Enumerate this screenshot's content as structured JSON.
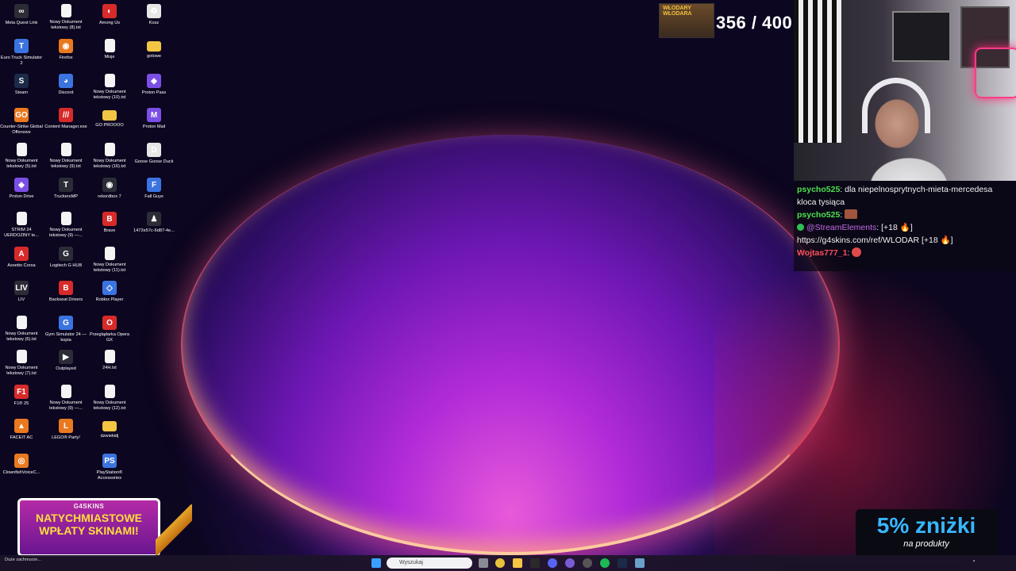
{
  "desktop": {
    "icons": [
      {
        "label": "Meta Quest Link",
        "glyph": "∞",
        "style": "g-dark",
        "icon": "meta-quest-icon"
      },
      {
        "label": "Euro Truck Simulator 2",
        "glyph": "🚚",
        "style": "g-blue",
        "icon": "truck-icon"
      },
      {
        "label": "Steam",
        "glyph": "S",
        "style": "g-steam",
        "icon": "steam-icon"
      },
      {
        "label": "Counter-Strike Global Offensive",
        "glyph": "GO",
        "style": "g-orange",
        "icon": "csgo-icon"
      },
      {
        "label": "Nowy Dokument tekstowy (5).txt",
        "glyph": "",
        "style": "g-doc",
        "icon": "text-file-icon"
      },
      {
        "label": "Proton Drive",
        "glyph": "◆",
        "style": "g-purple",
        "icon": "proton-drive-icon"
      },
      {
        "label": "STRIM 24 UERDOZINY te...",
        "glyph": "",
        "style": "g-doc",
        "icon": "text-file-icon"
      },
      {
        "label": "Assetto Corsa",
        "glyph": "A",
        "style": "g-red",
        "icon": "assetto-corsa-icon"
      },
      {
        "label": "LIV",
        "glyph": "LIV",
        "style": "g-dark",
        "icon": "liv-icon"
      },
      {
        "label": "Nowy Dokument tekstowy (6).txt",
        "glyph": "",
        "style": "g-doc",
        "icon": "text-file-icon"
      },
      {
        "label": "Nowy Dokument tekstowy (7).txt",
        "glyph": "",
        "style": "g-doc",
        "icon": "text-file-icon"
      },
      {
        "label": "F1® 25",
        "glyph": "F1",
        "style": "g-red",
        "icon": "f1-icon"
      },
      {
        "label": "FACEIT AC",
        "glyph": "▲",
        "style": "g-orange",
        "icon": "faceit-icon"
      },
      {
        "label": "ClownfishVoiceC...",
        "glyph": "◎",
        "style": "g-orange",
        "icon": "clownfish-icon"
      },
      {
        "label": "Nowy Dokument tekstowy (8).txt",
        "glyph": "",
        "style": "g-doc",
        "icon": "text-file-icon"
      },
      {
        "label": "Firefox",
        "glyph": "◉",
        "style": "g-orange",
        "icon": "firefox-icon"
      },
      {
        "label": "Discord",
        "glyph": "◕",
        "style": "g-blue",
        "icon": "discord-icon"
      },
      {
        "label": "Content Manager.exe",
        "glyph": "///",
        "style": "g-red",
        "icon": "content-manager-icon"
      },
      {
        "label": "Nowy Dokument tekstowy (9).txt",
        "glyph": "",
        "style": "g-doc",
        "icon": "text-file-icon"
      },
      {
        "label": "TruckersMP",
        "glyph": "T",
        "style": "g-dark",
        "icon": "truckersmp-icon"
      },
      {
        "label": "Nowy Dokument tekstowy (9) —...",
        "glyph": "",
        "style": "g-doc",
        "icon": "text-file-icon"
      },
      {
        "label": "Logitech G HUB",
        "glyph": "G",
        "style": "g-dark",
        "icon": "logitech-icon"
      },
      {
        "label": "Backseat Drivers",
        "glyph": "🚗",
        "style": "g-red",
        "icon": "backseat-drivers-icon"
      },
      {
        "label": "Gym Simulator 24 — kopia",
        "glyph": "🏋",
        "style": "g-blue",
        "icon": "gym-simulator-icon"
      },
      {
        "label": "Outplayed",
        "glyph": "▶",
        "style": "g-dark",
        "icon": "outplayed-icon"
      },
      {
        "label": "Nowy Dokument tekstowy (9) —...",
        "glyph": "",
        "style": "g-doc",
        "icon": "text-file-icon"
      },
      {
        "label": "LEGO® Party!",
        "glyph": "L",
        "style": "g-orange",
        "icon": "lego-icon"
      },
      {
        "label": "Among Us",
        "glyph": "◐",
        "style": "g-red",
        "icon": "among-us-icon"
      },
      {
        "label": "Misje",
        "glyph": "",
        "style": "g-doc",
        "icon": "text-file-icon"
      },
      {
        "label": "Nowy Dokument tekstowy (10).txt",
        "glyph": "",
        "style": "g-doc",
        "icon": "text-file-icon"
      },
      {
        "label": "GO PROOOO",
        "glyph": "",
        "style": "g-folder",
        "icon": "folder-icon"
      },
      {
        "label": "Nowy Dokument tekstowy (16).txt",
        "glyph": "",
        "style": "g-doc",
        "icon": "text-file-icon"
      },
      {
        "label": "rekordbox 7",
        "glyph": "◉",
        "style": "g-dark",
        "icon": "rekordbox-icon"
      },
      {
        "label": "Brave",
        "glyph": "B",
        "style": "g-red",
        "icon": "brave-icon"
      },
      {
        "label": "Nowy Dokument tekstowy (11).txt",
        "glyph": "",
        "style": "g-doc",
        "icon": "text-file-icon"
      },
      {
        "label": "Roblox Player",
        "glyph": "◇",
        "style": "g-blue",
        "icon": "roblox-icon"
      },
      {
        "label": "Przeglądarka Opera GX",
        "glyph": "O",
        "style": "g-red",
        "icon": "opera-gx-icon"
      },
      {
        "label": "24H.txt",
        "glyph": "",
        "style": "g-doc",
        "icon": "text-file-icon"
      },
      {
        "label": "Nowy Dokument tekstowy (12).txt",
        "glyph": "",
        "style": "g-doc",
        "icon": "text-file-icon"
      },
      {
        "label": "dzwiekidj",
        "glyph": "",
        "style": "g-folder",
        "icon": "folder-icon"
      },
      {
        "label": "PlayStation® Accessories",
        "glyph": "PS",
        "style": "g-blue",
        "icon": "playstation-icon"
      },
      {
        "label": "Kosz",
        "glyph": "🗑",
        "style": "g-white",
        "icon": "recycle-bin-icon"
      },
      {
        "label": "gotowe",
        "glyph": "",
        "style": "g-folder",
        "icon": "folder-icon"
      },
      {
        "label": "Proton Pass",
        "glyph": "◆",
        "style": "g-purple",
        "icon": "proton-pass-icon"
      },
      {
        "label": "Proton Mail",
        "glyph": "M",
        "style": "g-purple",
        "icon": "proton-mail-icon"
      },
      {
        "label": "Goose Goose Duck",
        "glyph": "🦆",
        "style": "g-white",
        "icon": "goose-goose-duck-icon"
      },
      {
        "label": "Fall Guys",
        "glyph": "F",
        "style": "g-blue",
        "icon": "fall-guys-icon"
      },
      {
        "label": "1472e57c-6d87-4e...",
        "glyph": "♟",
        "style": "g-dark",
        "icon": "image-file-icon"
      }
    ]
  },
  "overlay": {
    "counter_image_label": "WŁODARY WŁODARA",
    "counter": "356 / 400",
    "promo_left": {
      "brand": "G4SKINS",
      "line1": "NATYCHMIASTOWE",
      "line2": "WPŁATY SKINAMI!"
    },
    "promo_right": {
      "big": "5% zniżki",
      "small": "na produkty"
    }
  },
  "chat": {
    "messages": [
      {
        "user": "psycho525",
        "text": "dla niepelnosprytnych-mieta-mercedesa kloca tysiąca"
      },
      {
        "user": "psycho525",
        "text": ""
      },
      {
        "user": "@StreamElements",
        "text": "[+18 🔥]"
      },
      {
        "user": "",
        "text": "https://g4skins.com/ref/WLODAR [+18 🔥]"
      },
      {
        "user": "Wojtas777_1",
        "text": ""
      }
    ]
  },
  "taskbar": {
    "search_placeholder": "Wyszukaj",
    "weather": "Duże zachmurze..."
  }
}
